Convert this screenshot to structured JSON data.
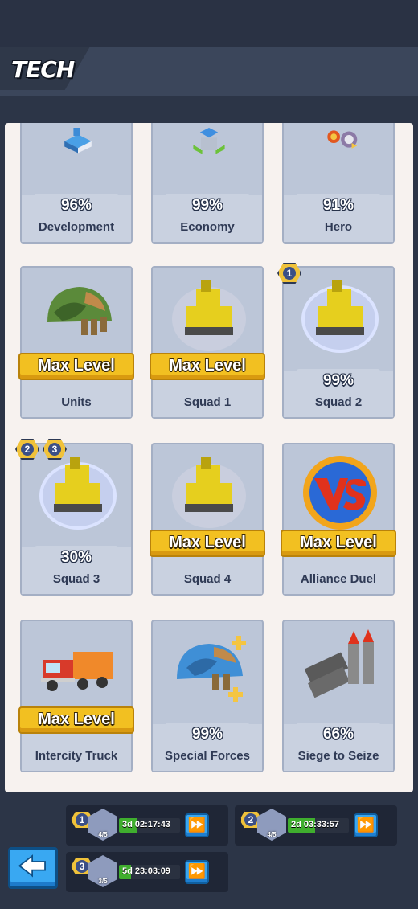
{
  "header": {
    "title": "TECH"
  },
  "tech_cards": [
    {
      "name": "Development",
      "progress": "96%",
      "max_level": ""
    },
    {
      "name": "Economy",
      "progress": "99%",
      "max_level": ""
    },
    {
      "name": "Hero",
      "progress": "91%",
      "max_level": ""
    },
    {
      "name": "Units",
      "progress": "",
      "max_level": "Max Level"
    },
    {
      "name": "Squad 1",
      "progress": "",
      "max_level": "Max Level"
    },
    {
      "name": "Squad 2",
      "progress": "99%",
      "max_level": "",
      "badges": [
        "1"
      ]
    },
    {
      "name": "Squad 3",
      "progress": "30%",
      "max_level": "",
      "badges": [
        "2",
        "3"
      ]
    },
    {
      "name": "Squad 4",
      "progress": "",
      "max_level": "Max Level"
    },
    {
      "name": "Alliance Duel",
      "progress": "",
      "max_level": "Max Level"
    },
    {
      "name": "Intercity Truck",
      "progress": "",
      "max_level": "Max Level"
    },
    {
      "name": "Special Forces",
      "progress": "99%",
      "max_level": ""
    },
    {
      "name": "Siege to Seize",
      "progress": "66%",
      "max_level": ""
    }
  ],
  "research_queue": [
    {
      "slot": "1",
      "count": "4/5",
      "timer": "3d 02:17:43",
      "progress": 0.3
    },
    {
      "slot": "2",
      "count": "4/5",
      "timer": "2d 03:33:57",
      "progress": 0.45
    },
    {
      "slot": "3",
      "count": "3/5",
      "timer": "5d 23:03:09",
      "progress": 0.2
    }
  ],
  "colors": {
    "background": "#2c3547",
    "panel": "#f7f2ef",
    "card": "#bcc6d8",
    "max_badge": "#f2c021",
    "timer_fill": "#3fae2e",
    "speedup_button": "#3aa7f0"
  },
  "icons": {
    "back_button": "left-arrow-icon",
    "speedup": "fast-forward-icon"
  }
}
